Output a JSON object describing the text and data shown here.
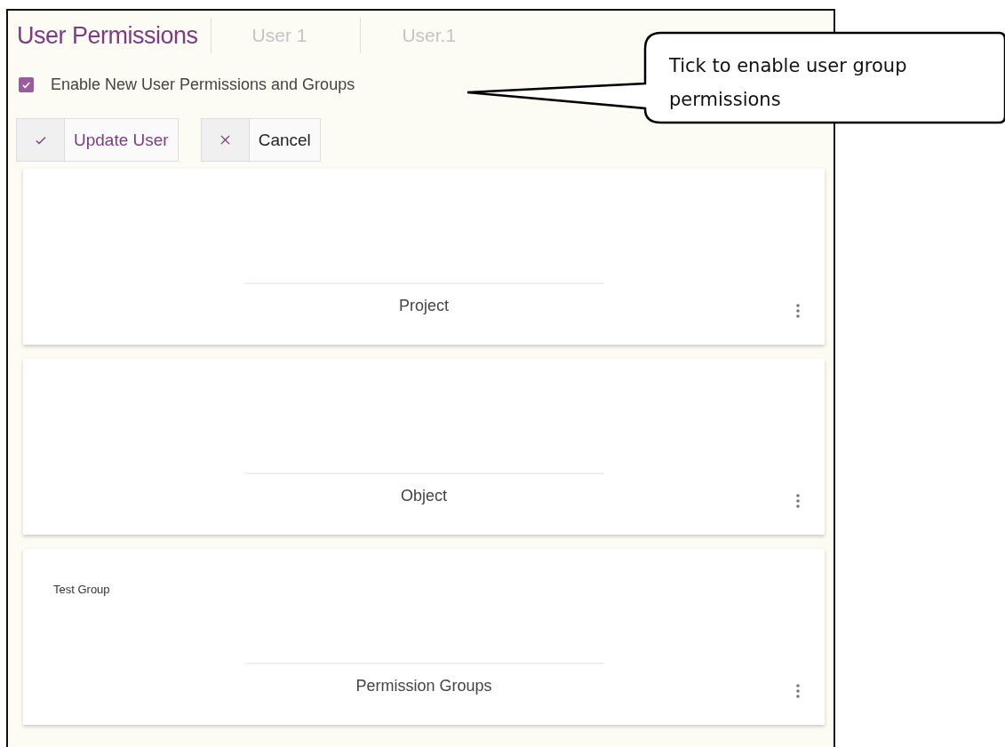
{
  "header": {
    "title": "User Permissions",
    "tabs": [
      {
        "label": "User 1",
        "selected": false
      },
      {
        "label": "User.1",
        "selected": false
      }
    ]
  },
  "enable_option": {
    "label": "Enable New User Permissions and Groups",
    "checked": true
  },
  "buttons": [
    {
      "kind": "confirm",
      "label": "Update User"
    },
    {
      "kind": "cancel",
      "label": "Cancel"
    }
  ],
  "cards": [
    {
      "title": "Project"
    },
    {
      "title": "Object"
    },
    {
      "title": "Permission Groups",
      "items": [
        "Test Group"
      ]
    }
  ],
  "callout": {
    "text": "Tick to enable user group permissions"
  }
}
